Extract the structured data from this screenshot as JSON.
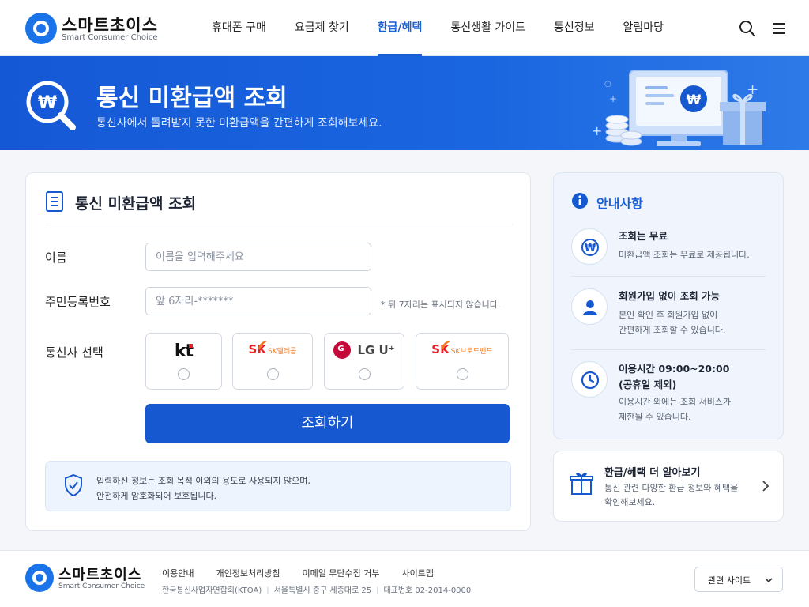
{
  "brand": {
    "name": "스마트초이스",
    "tagline": "Smart Consumer Choice"
  },
  "nav": {
    "items": [
      {
        "label": "휴대폰 구매"
      },
      {
        "label": "요금제 찾기"
      },
      {
        "label": "환급/혜택",
        "active": true
      },
      {
        "label": "통신생활 가이드"
      },
      {
        "label": "통신정보"
      },
      {
        "label": "알림마당"
      }
    ],
    "search_icon": "search-icon",
    "menu_icon": "hamburger-menu-icon"
  },
  "hero": {
    "title": "통신 미환급액 조회",
    "subtitle": "통신사에서 돌려받지 못한 미환급액을 간편하게 조회해보세요.",
    "icon": "won-magnifier-icon",
    "currency_symbol": "₩"
  },
  "form": {
    "title": "통신 미환급액 조회",
    "name_label": "이름",
    "name_placeholder": "이름을 입력해주세요",
    "name_value": "",
    "rrn_label": "주민등록번호",
    "rrn_placeholder": "앞 6자리-*******",
    "rrn_value": "",
    "rrn_note": "* 뒤 7자리는 표시되지 않습니다.",
    "carrier_label": "통신사 선택",
    "carriers": [
      {
        "name": "kt",
        "selected": false
      },
      {
        "mark": "SK",
        "name": "SK텔레콤",
        "selected": false
      },
      {
        "name": "LG U⁺",
        "selected": false
      },
      {
        "mark": "SK",
        "name": "SK브로드밴드",
        "selected": false
      }
    ],
    "submit_label": "조회하기",
    "privacy_line1": "입력하신 정보는 조회 목적 이외의 용도로 사용되지 않으며,",
    "privacy_line2": "안전하게 암호화되어 보호됩니다."
  },
  "notice": {
    "title": "안내사항",
    "items": [
      {
        "icon": "won-icon",
        "title": "조회는 무료",
        "desc": [
          "미환급액 조회는 무료로 제공됩니다."
        ]
      },
      {
        "icon": "user-icon",
        "title": "회원가입 없이 조회 가능",
        "desc": [
          "본인 확인 후 회원가입 없이",
          "간편하게 조회할 수 있습니다."
        ]
      },
      {
        "icon": "clock-icon",
        "title": "이용시간 09:00~20:00",
        "title2": "(공휴일 제외)",
        "desc": [
          "이용시간 외에는 조회 서비스가",
          "제한될 수 있습니다."
        ]
      }
    ]
  },
  "benefit": {
    "title": "환급/혜택 더 알아보기",
    "desc1": "통신 관련 다양한 환급 정보와 혜택을",
    "desc2": "확인해보세요."
  },
  "footer": {
    "links": [
      "이용안내",
      "개인정보처리방침",
      "이메일 무단수집 거부",
      "사이트맵"
    ],
    "org": "한국통신사업자연합회(KTOA)",
    "address": "서울특별시 중구 세종대로 25",
    "phone": "대표번호 02-2014-0000",
    "related_label": "관련 사이트"
  },
  "colors": {
    "primary": "#1558cf",
    "hero_bg": "#1a66e0",
    "accent_red": "#e8202a",
    "accent_orange": "#f47920",
    "lg_red": "#c6093b"
  }
}
